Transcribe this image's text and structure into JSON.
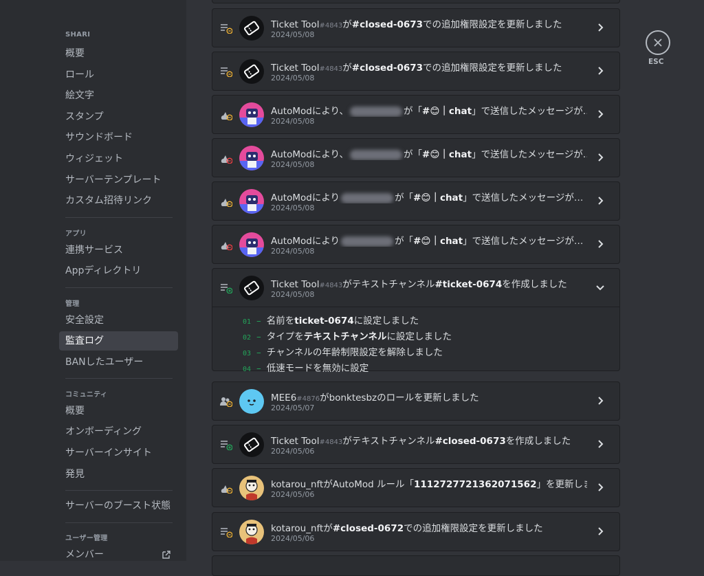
{
  "sidebar": {
    "sections": [
      {
        "title": "SHARI",
        "items": [
          "概要",
          "ロール",
          "絵文字",
          "スタンプ",
          "サウンドボード",
          "ウィジェット",
          "サーバーテンプレート",
          "カスタム招待リンク"
        ]
      },
      {
        "title": "アプリ",
        "items": [
          "連携サービス",
          "Appディレクトリ"
        ]
      },
      {
        "title": "管理",
        "items": [
          "安全設定",
          "監査ログ",
          "BANしたユーザー"
        ]
      },
      {
        "title": "コミュニティ",
        "items": [
          "概要",
          "オンボーディング",
          "サーバーインサイト",
          "発見"
        ]
      },
      {
        "title": "",
        "items": [
          "サーバーのブースト状態"
        ]
      },
      {
        "title": "ユーザー管理",
        "items": [
          "メンバー"
        ]
      }
    ],
    "active_item": "監査ログ"
  },
  "close": {
    "label": "ESC",
    "icon": "close-icon"
  },
  "entries": [
    {
      "actor": "Ticket Tool",
      "tag": "#4843",
      "text_a": "が",
      "bold_a": "#closed-0673",
      "text_b": "での追加権限設定を更新しました",
      "date": "2024/05/08",
      "icon": "channel-update-icon",
      "avatar": "ticket-tool-avatar"
    },
    {
      "actor": "Ticket Tool",
      "tag": "#4843",
      "text_a": "が",
      "bold_a": "#closed-0673",
      "text_b": "での追加権限設定を更新しました",
      "date": "2024/05/08",
      "icon": "channel-update-icon",
      "avatar": "ticket-tool-avatar"
    },
    {
      "actor": "AutoModにより、",
      "tag": "",
      "text_a": "が「",
      "bold_a": "#😊｜chat",
      "text_b": "」で送信したメッセージが…",
      "date": "2024/05/08",
      "icon": "automod-update-icon",
      "avatar": "automod-avatar"
    },
    {
      "actor": "AutoModにより、",
      "tag": "",
      "text_a": "が「",
      "bold_a": "#😊｜chat",
      "text_b": "」で送信したメッセージが…",
      "date": "2024/05/08",
      "icon": "automod-delete-icon",
      "avatar": "automod-avatar"
    },
    {
      "actor": "AutoModにより",
      "tag": "",
      "text_a": "が「",
      "bold_a": "#😊｜chat",
      "text_b": "」で送信したメッセージが…",
      "date": "2024/05/08",
      "icon": "automod-update-icon",
      "avatar": "automod-avatar"
    },
    {
      "actor": "AutoModにより",
      "tag": "",
      "text_a": "が「",
      "bold_a": "#😊｜chat",
      "text_b": "」で送信したメッセージが…",
      "date": "2024/05/08",
      "icon": "automod-delete-icon",
      "avatar": "automod-avatar"
    },
    {
      "actor": "Ticket Tool",
      "tag": "#4843",
      "text_a": "がテキストチャンネル",
      "bold_a": "#ticket-0674",
      "text_b": "を作成しました",
      "date": "2024/05/08",
      "icon": "channel-create-icon",
      "avatar": "ticket-tool-avatar",
      "expanded": true,
      "details": [
        {
          "num": "01",
          "text_a": "名前を",
          "bold": "ticket-0674",
          "text_b": "に設定しました"
        },
        {
          "num": "02",
          "text_a": "タイプを",
          "bold": "テキストチャンネル",
          "text_b": "に設定しました"
        },
        {
          "num": "03",
          "text_a": "チャンネルの年齢制限設定を解除しました",
          "bold": "",
          "text_b": ""
        },
        {
          "num": "04",
          "text_a": "低速モードを無効に設定",
          "bold": "",
          "text_b": ""
        }
      ]
    },
    {
      "actor": "MEE6",
      "tag": "#4876",
      "text_a": "がbonktesbzのロールを更新しました",
      "bold_a": "",
      "text_b": "",
      "date": "2024/05/07",
      "icon": "member-role-icon",
      "avatar": "mee6-avatar"
    },
    {
      "actor": "Ticket Tool",
      "tag": "#4843",
      "text_a": "がテキストチャンネル",
      "bold_a": "#closed-0673",
      "text_b": "を作成しました",
      "date": "2024/05/06",
      "icon": "channel-create-icon",
      "avatar": "ticket-tool-avatar"
    },
    {
      "actor": "kotarou_nft",
      "tag": "",
      "text_a": "がAutoMod ルール「",
      "bold_a": "1112727721362071562",
      "text_b": "」を更新しました",
      "date": "2024/05/06",
      "icon": "automod-update-icon",
      "avatar": "kotarou-avatar"
    },
    {
      "actor": "kotarou_nft",
      "tag": "",
      "text_a": "が",
      "bold_a": "#closed-0672",
      "text_b": "での追加権限設定を更新しました",
      "date": "2024/05/06",
      "icon": "channel-update-icon",
      "avatar": "kotarou-avatar"
    }
  ],
  "colors": {
    "accent_green": "#23a55a",
    "update_orange": "#f0b232",
    "delete_red": "#f23f43"
  }
}
